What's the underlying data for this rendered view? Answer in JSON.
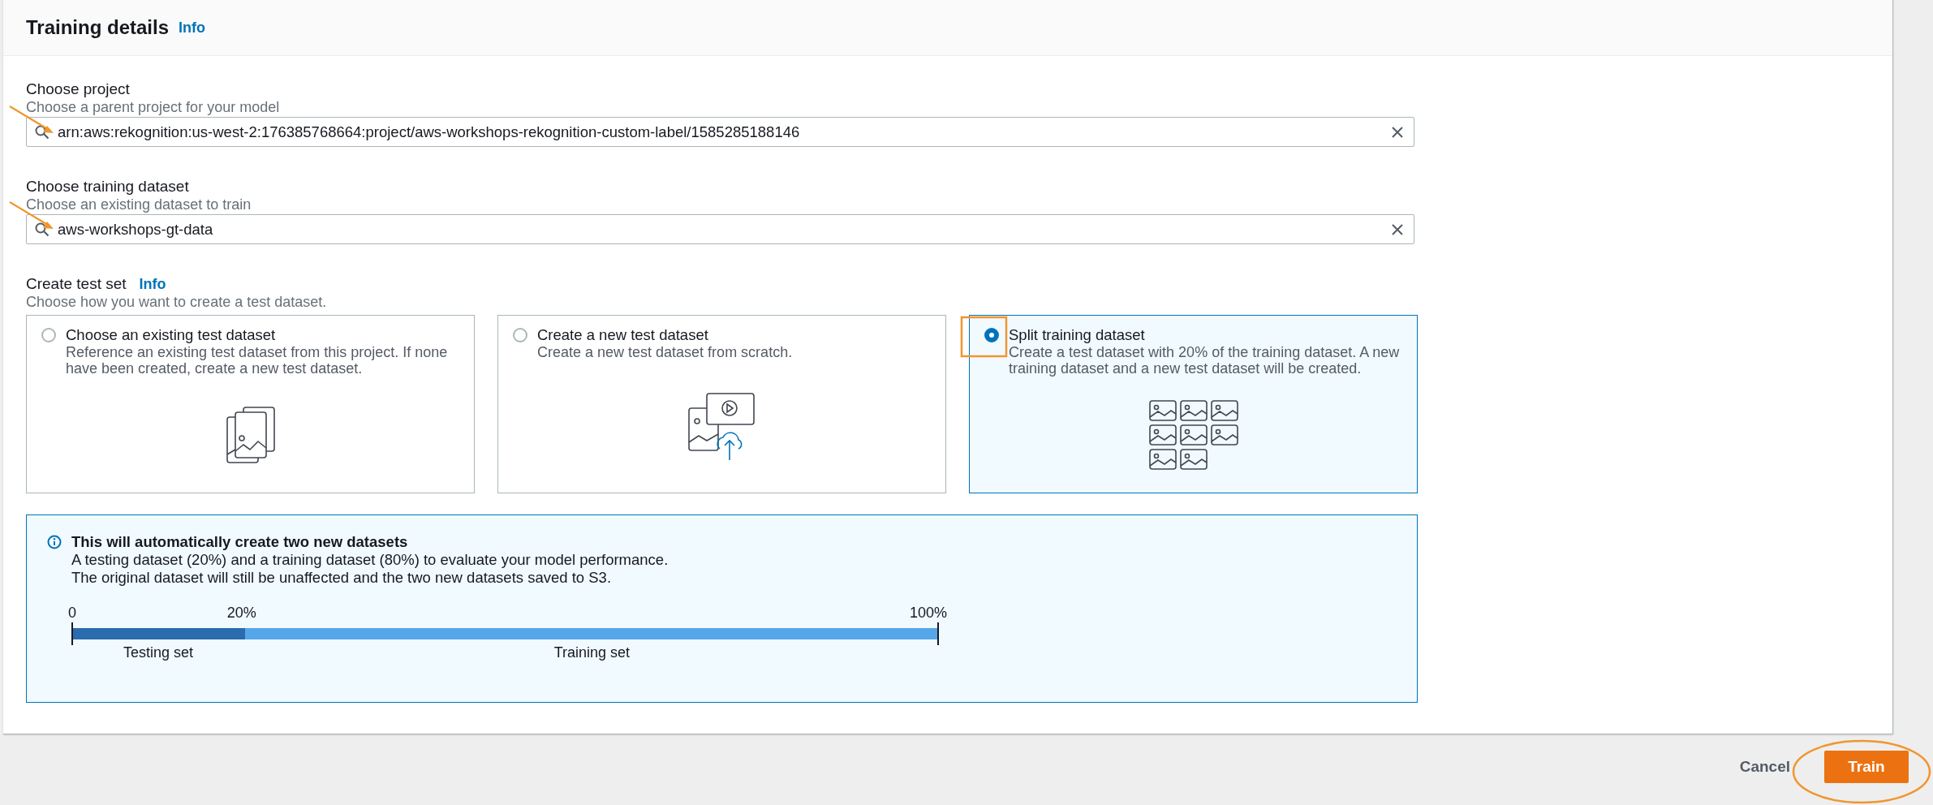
{
  "header": {
    "title": "Training details",
    "info_link": "Info"
  },
  "fields": [
    {
      "label": "Choose project",
      "description": "Choose a parent project for your model",
      "value": "arn:aws:rekognition:us-west-2:176385768664:project/aws-workshops-rekognition-custom-label/1585285188146"
    },
    {
      "label": "Choose training dataset",
      "description": "Choose an existing dataset to train",
      "value": "aws-workshops-gt-data"
    }
  ],
  "test_set": {
    "label": "Create test set",
    "info_link": "Info",
    "description": "Choose how you want to create a test dataset.",
    "options": [
      {
        "kind": "existing",
        "title": "Choose an existing test dataset",
        "description": "Reference an existing test dataset from this project. If none have been created, create a new test dataset.",
        "selected": false
      },
      {
        "kind": "new",
        "title": "Create a new test dataset",
        "description": "Create a new test dataset from scratch.",
        "selected": false
      },
      {
        "kind": "split",
        "title": "Split training dataset",
        "description": "Create a test dataset with 20% of the training dataset. A new training dataset and a new test dataset will be created.",
        "selected": true
      }
    ]
  },
  "info_box": {
    "title": "This will automatically create two new datasets",
    "lines": [
      "A testing dataset (20%) and a training dataset (80%) to evaluate your model performance.",
      "The original dataset will still be unaffected and the two new datasets saved to S3."
    ],
    "split_bar": {
      "level": 0.2,
      "ticks": [
        "0",
        "20%",
        "100%"
      ],
      "labels": [
        "Testing set",
        "Training set"
      ]
    }
  },
  "buttons": {
    "cancel": "Cancel",
    "train": "Train"
  }
}
